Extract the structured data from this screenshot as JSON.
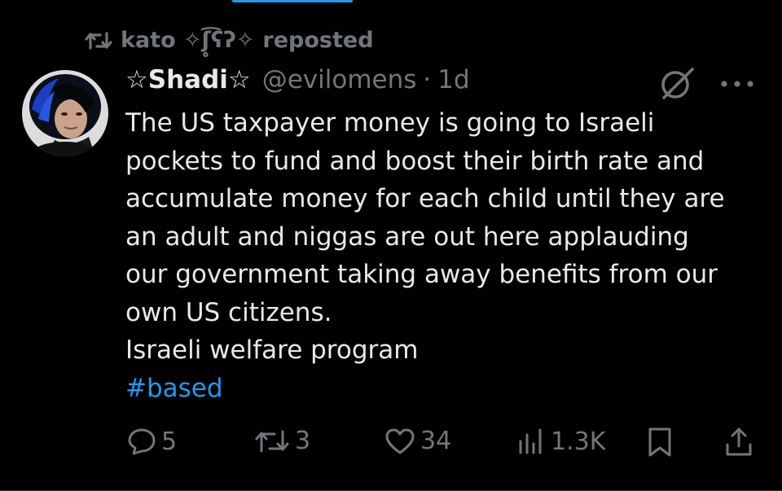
{
  "repost": {
    "user": "kato ✧ʃ̥̥̥̥͡ʕʔ✧",
    "label": "reposted"
  },
  "author": {
    "display_name": "☆Shadi☆",
    "handle": "@evilomens",
    "separator": "·",
    "time": "1d"
  },
  "tweet": {
    "lines": [
      "The US taxpayer money is going to Israeli",
      "pockets to fund and boost their birth rate and",
      "accumulate money for each child until they are",
      "an adult and niggas are out here applauding",
      "our government taking away benefits from our",
      "own US citizens.",
      "Israeli welfare program"
    ],
    "hashtag": "#based"
  },
  "actions": {
    "replies": "5",
    "reposts": "3",
    "likes": "34",
    "views": "1.3K"
  },
  "icons": {
    "repost": "repost-icon",
    "grok": "grok-icon",
    "more": "more-icon",
    "reply": "reply-icon",
    "like": "heart-icon",
    "views": "views-icon",
    "bookmark": "bookmark-icon",
    "share": "share-icon"
  },
  "colors": {
    "background": "#000000",
    "text": "#e7e9ea",
    "muted": "#71767b",
    "accent": "#1d9bf0"
  }
}
